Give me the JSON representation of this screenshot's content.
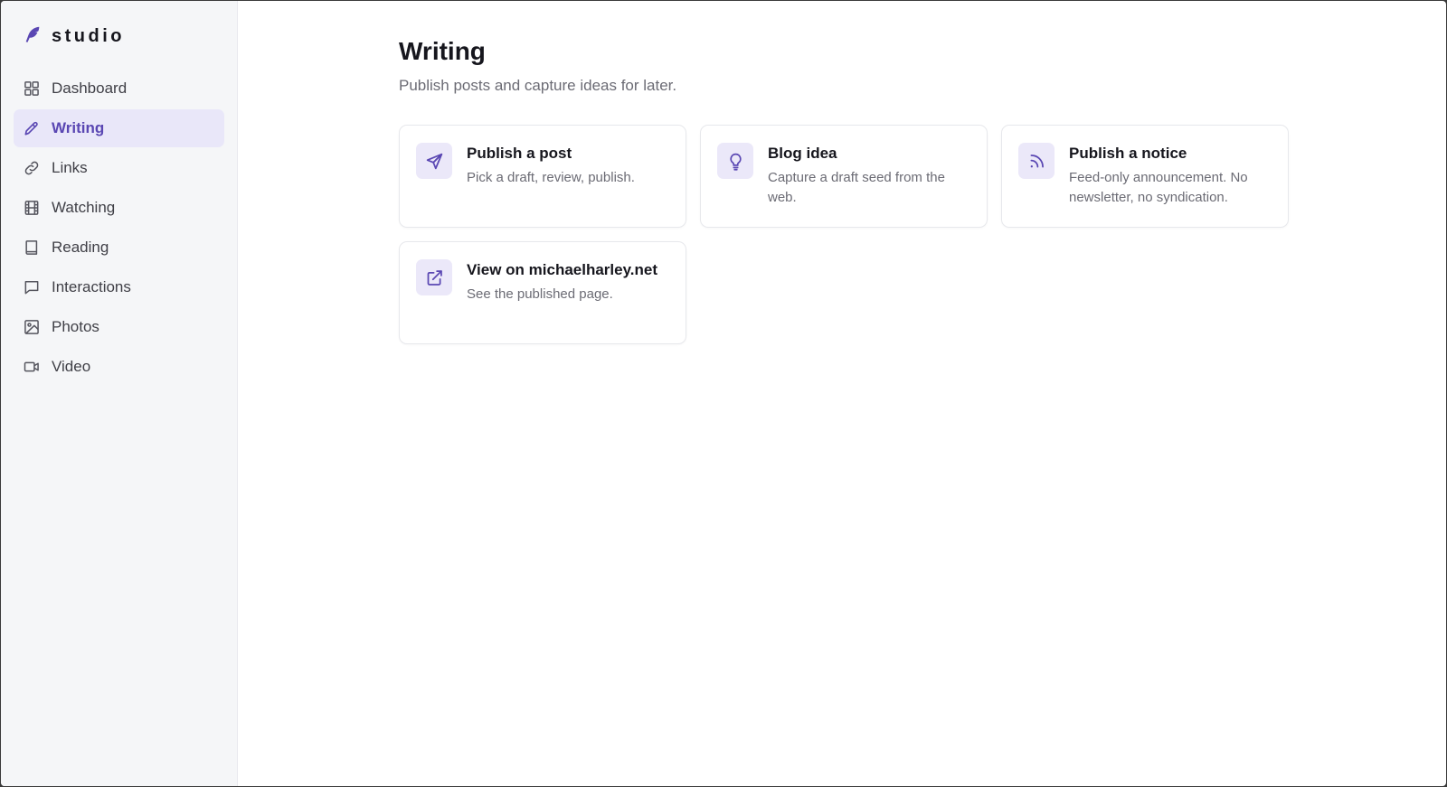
{
  "brand": {
    "name": "studio",
    "icon": "feather-icon"
  },
  "colors": {
    "accent": "#5a47b3",
    "active_bg": "#e9e7f9",
    "sidebar_bg": "#f5f6f8"
  },
  "sidebar": {
    "items": [
      {
        "label": "Dashboard",
        "icon": "grid-icon",
        "active": false
      },
      {
        "label": "Writing",
        "icon": "pencil-icon",
        "active": true
      },
      {
        "label": "Links",
        "icon": "link-icon",
        "active": false
      },
      {
        "label": "Watching",
        "icon": "film-icon",
        "active": false
      },
      {
        "label": "Reading",
        "icon": "book-icon",
        "active": false
      },
      {
        "label": "Interactions",
        "icon": "chat-icon",
        "active": false
      },
      {
        "label": "Photos",
        "icon": "image-icon",
        "active": false
      },
      {
        "label": "Video",
        "icon": "video-icon",
        "active": false
      }
    ]
  },
  "main": {
    "title": "Writing",
    "subtitle": "Publish posts and capture ideas for later.",
    "cards": [
      {
        "title": "Publish a post",
        "desc": "Pick a draft, review, publish.",
        "icon": "send-icon"
      },
      {
        "title": "Blog idea",
        "desc": "Capture a draft seed from the web.",
        "icon": "lightbulb-icon"
      },
      {
        "title": "Publish a notice",
        "desc": "Feed-only announcement. No newsletter, no syndication.",
        "icon": "rss-icon"
      },
      {
        "title": "View on michaelharley.net",
        "desc": "See the published page.",
        "icon": "external-link-icon"
      }
    ]
  }
}
